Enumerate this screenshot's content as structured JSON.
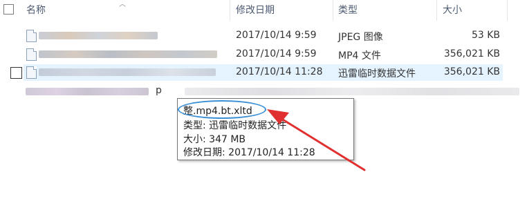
{
  "header": {
    "name": "名称",
    "modified": "修改日期",
    "type": "类型",
    "size": "大小"
  },
  "rows": [
    {
      "date": "2017/10/14 9:59",
      "type": "JPEG 图像",
      "size": "53 KB"
    },
    {
      "date": "2017/10/14 9:59",
      "type": "MP4 文件",
      "size": "356,021 KB"
    },
    {
      "date": "2017/10/14 11:28",
      "type": "迅雷临时数据文件",
      "size": "356,021 KB"
    },
    {
      "name_fragment": "p"
    }
  ],
  "tooltip": {
    "filename": "整.mp4.bt.xltd",
    "type": "类型: 迅雷临时数据文件",
    "size": "大小: 347 MB",
    "modified": "修改日期: 2017/10/14 11:28"
  },
  "colors": {
    "selection": "#e5f3ff",
    "annotation_arrow": "#e03030",
    "annotation_circle": "#3a8fd6"
  },
  "icons": [
    "image-file-icon",
    "video-file-icon",
    "xunlei-temp-file-icon"
  ]
}
